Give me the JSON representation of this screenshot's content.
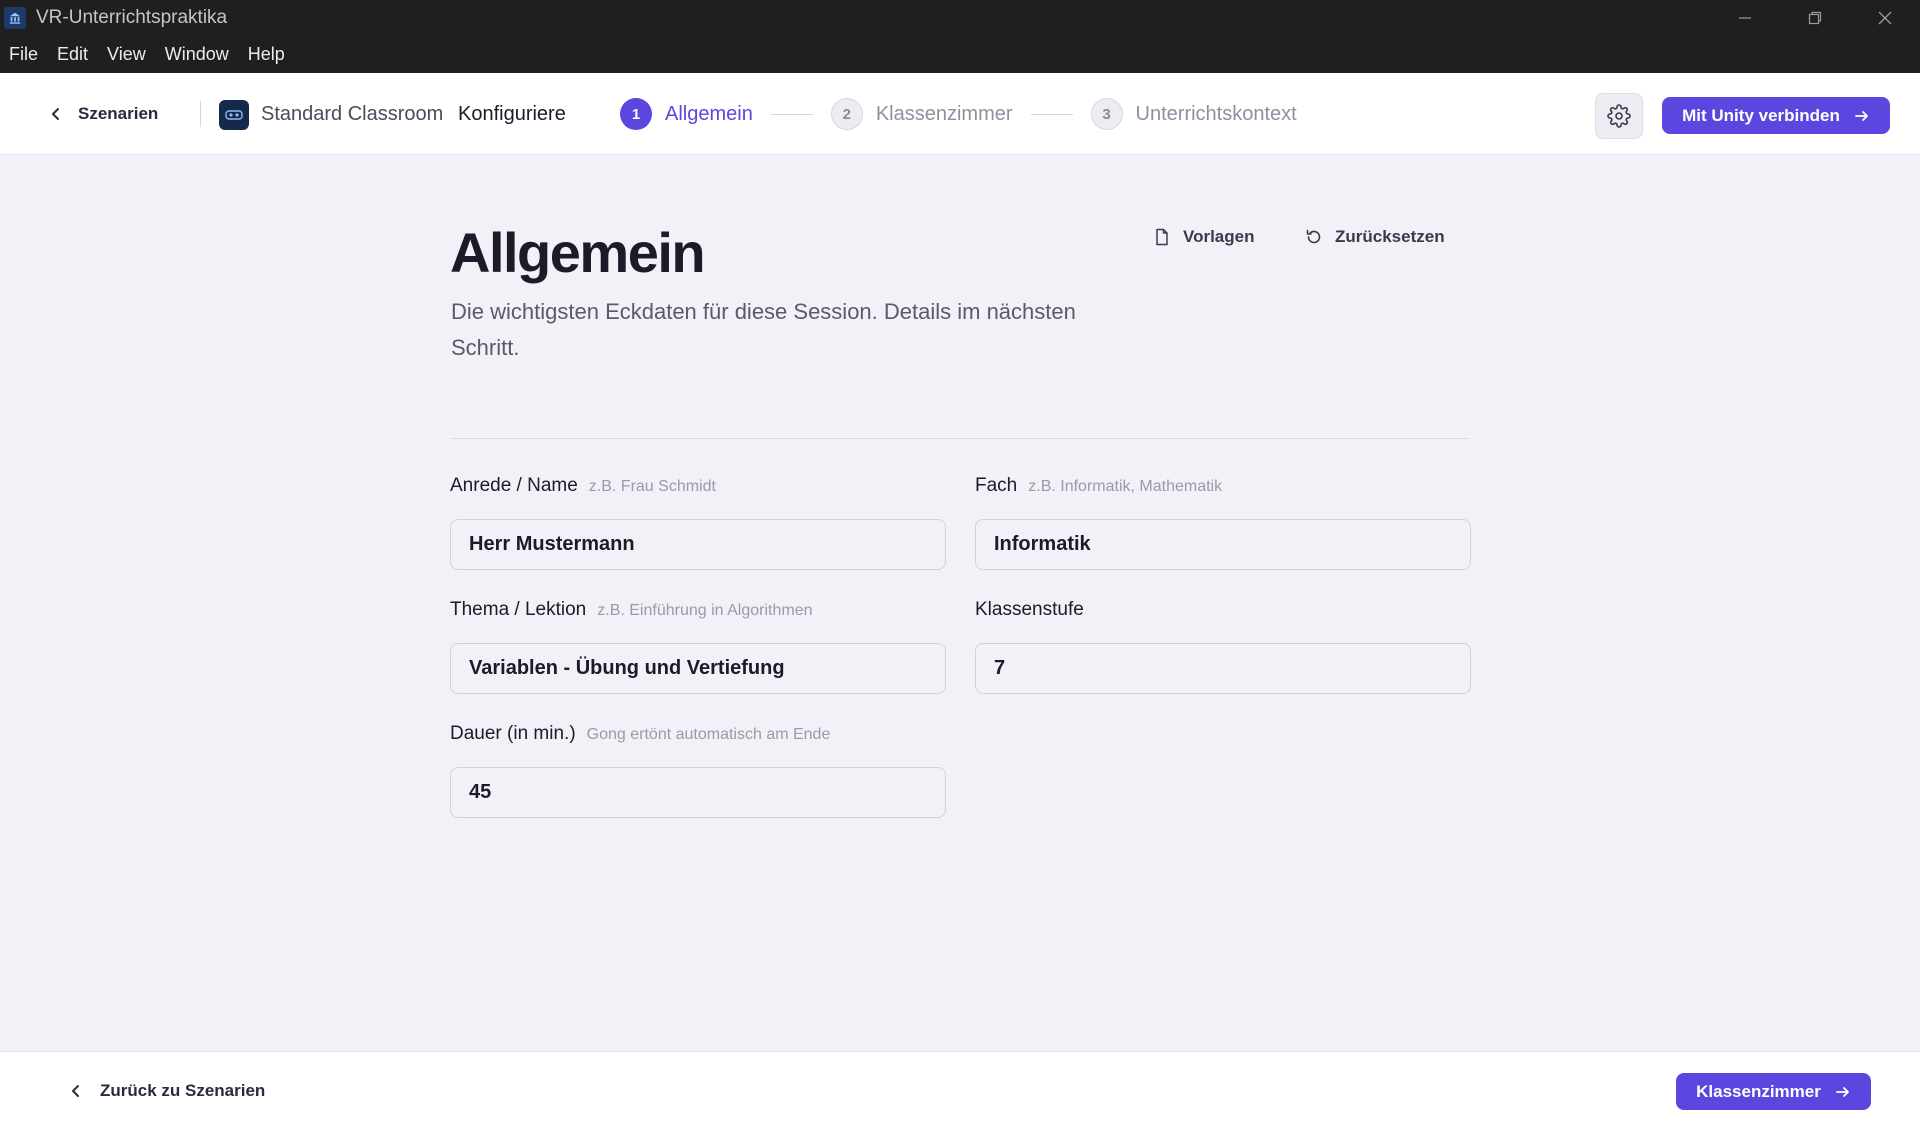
{
  "window": {
    "title": "VR-Unterrichtspraktika",
    "app_icon": "classroom-app-icon",
    "controls": [
      "minimize-icon",
      "restore-icon",
      "close-icon"
    ]
  },
  "menu": [
    "File",
    "Edit",
    "View",
    "Window",
    "Help"
  ],
  "header": {
    "back_label": "Szenarien",
    "scenario_name": "Standard Classroom",
    "configure_label": "Konfiguriere",
    "steps": [
      {
        "number": "1",
        "label": "Allgemein",
        "state": "active"
      },
      {
        "number": "2",
        "label": "Klassenzimmer",
        "state": "inactive"
      },
      {
        "number": "3",
        "label": "Unterrichtskontext",
        "state": "inactive"
      }
    ],
    "settings_icon": "gear-icon",
    "connect_button": "Mit Unity verbinden"
  },
  "main": {
    "title": "Allgemein",
    "subtitle": "Die wichtigsten Eckdaten für diese Session. Details im nächsten Schritt.",
    "actions": {
      "templates": "Vorlagen",
      "reset": "Zurücksetzen"
    },
    "fields": {
      "name": {
        "label": "Anrede / Name",
        "hint": "z.B. Frau Schmidt",
        "value": "Herr Mustermann"
      },
      "subject": {
        "label": "Fach",
        "hint": "z.B. Informatik, Mathematik",
        "value": "Informatik"
      },
      "topic": {
        "label": "Thema / Lektion",
        "hint": "z.B. Einführung in Algorithmen",
        "value": "Variablen - Übung und Vertiefung"
      },
      "grade": {
        "label": "Klassenstufe",
        "hint": "",
        "value": "7"
      },
      "duration": {
        "label": "Dauer (in min.)",
        "hint": "Gong ertönt automatisch am Ende",
        "value": "45"
      }
    }
  },
  "footer": {
    "back_label": "Zurück zu Szenarien",
    "next_button": "Klassenzimmer"
  },
  "colors": {
    "accent": "#5b47e0",
    "background": "#f1f1f8",
    "titlebar": "#1f1f1f"
  }
}
